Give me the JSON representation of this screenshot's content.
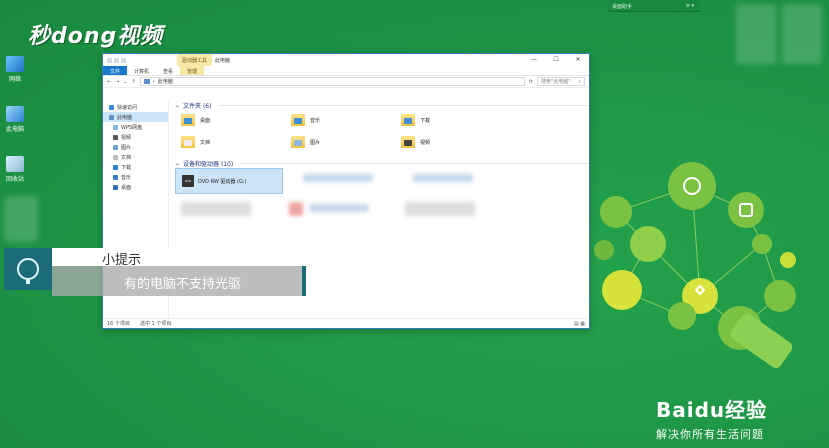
{
  "watermark": {
    "logo_text": "秒dong视频",
    "baidu_text": "Baidu经验",
    "baidu_tagline": "解决你所有生活问题"
  },
  "desktop_icons": [
    {
      "label": "网络",
      "icon": "network-icon"
    },
    {
      "label": "此电脑",
      "icon": "this-pc-icon"
    },
    {
      "label": "回收站",
      "icon": "recycle-bin-icon"
    }
  ],
  "gadget": {
    "label": "桌面助手",
    "controls": "≡ ▾"
  },
  "window": {
    "drive_tools_tab": "驱动器工具",
    "title": "此电脑",
    "controls": {
      "minimize": "—",
      "maximize": "☐",
      "close": "✕"
    },
    "ribbon_tabs": [
      "文件",
      "计算机",
      "查看",
      "管理"
    ],
    "address": {
      "path": "此电脑",
      "search_placeholder": "搜索\"此电脑\""
    },
    "nav_pane": [
      {
        "label": "快速访问",
        "icon": "star-icon"
      },
      {
        "label": "此电脑",
        "icon": "computer-icon"
      },
      {
        "label": "WPS网盘",
        "icon": "cloud-icon"
      },
      {
        "label": "视频",
        "icon": "video-icon"
      },
      {
        "label": "图片",
        "icon": "picture-icon"
      },
      {
        "label": "文档",
        "icon": "document-icon"
      },
      {
        "label": "下载",
        "icon": "download-icon"
      },
      {
        "label": "音乐",
        "icon": "music-icon"
      },
      {
        "label": "桌面",
        "icon": "desktop-icon"
      }
    ],
    "folders_header": "文件夹 (6)",
    "folders": [
      "桌面",
      "音乐",
      "下载",
      "文档",
      "图片",
      "视频"
    ],
    "drives_header": "设备和驱动器 (10)",
    "selected_drive": "DVD RW 驱动器 (G:)",
    "status": {
      "count": "16 个项目",
      "selected": "选中 1 个项目"
    }
  },
  "tip": {
    "title": "小提示",
    "body": "有的电脑不支持光驱"
  },
  "colors": {
    "desktop": "#1f9a48",
    "accent": "#1979ca",
    "tip_dark": "#1c6b7a"
  }
}
